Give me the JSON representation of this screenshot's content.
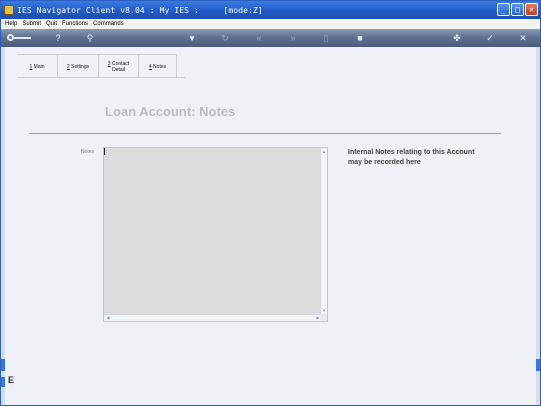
{
  "window": {
    "title": "IES Navigator Client v8.04 : My IES :     [mode:Z]",
    "controls": {
      "minimize": "_",
      "maximize": "□",
      "close": "×"
    }
  },
  "menu": [
    "Help",
    "Submit",
    "Quit",
    "Functions",
    "Commands"
  ],
  "toolbar": {
    "icons": [
      {
        "name": "key-icon",
        "glyph": ""
      },
      {
        "name": "help-icon",
        "glyph": "?"
      },
      {
        "name": "search-icon",
        "glyph": "⚲"
      },
      {
        "name": "heart-icon",
        "glyph": "♥"
      },
      {
        "name": "refresh-icon",
        "glyph": "↻"
      },
      {
        "name": "rewind-icon",
        "glyph": "«"
      },
      {
        "name": "fast-forward-icon",
        "glyph": "»"
      },
      {
        "name": "document-icon",
        "glyph": "▯"
      },
      {
        "name": "save-icon",
        "glyph": "■"
      },
      {
        "name": "tools-icon",
        "glyph": "✤"
      },
      {
        "name": "ok-icon",
        "glyph": "✓"
      },
      {
        "name": "cancel-icon",
        "glyph": "✕"
      }
    ]
  },
  "tabs": [
    {
      "key": "1",
      "label": "Main"
    },
    {
      "key": "2",
      "label": "Settings"
    },
    {
      "key": "3",
      "label": "Contact",
      "label2": "Detail"
    },
    {
      "key": "4",
      "label": "Notes"
    }
  ],
  "page": {
    "title": "Loan Account: Notes",
    "notes_label": "Notes",
    "notes_value": "",
    "help_text": "Internal Notes relating to this Account may be recorded here"
  },
  "side": {
    "glyph": "E"
  },
  "colors": {
    "titlebar": "#1f58c4",
    "toolbar": "#5d6f8f",
    "notes_bg": "#dcdcdc",
    "page_title": "#b9bec6"
  }
}
